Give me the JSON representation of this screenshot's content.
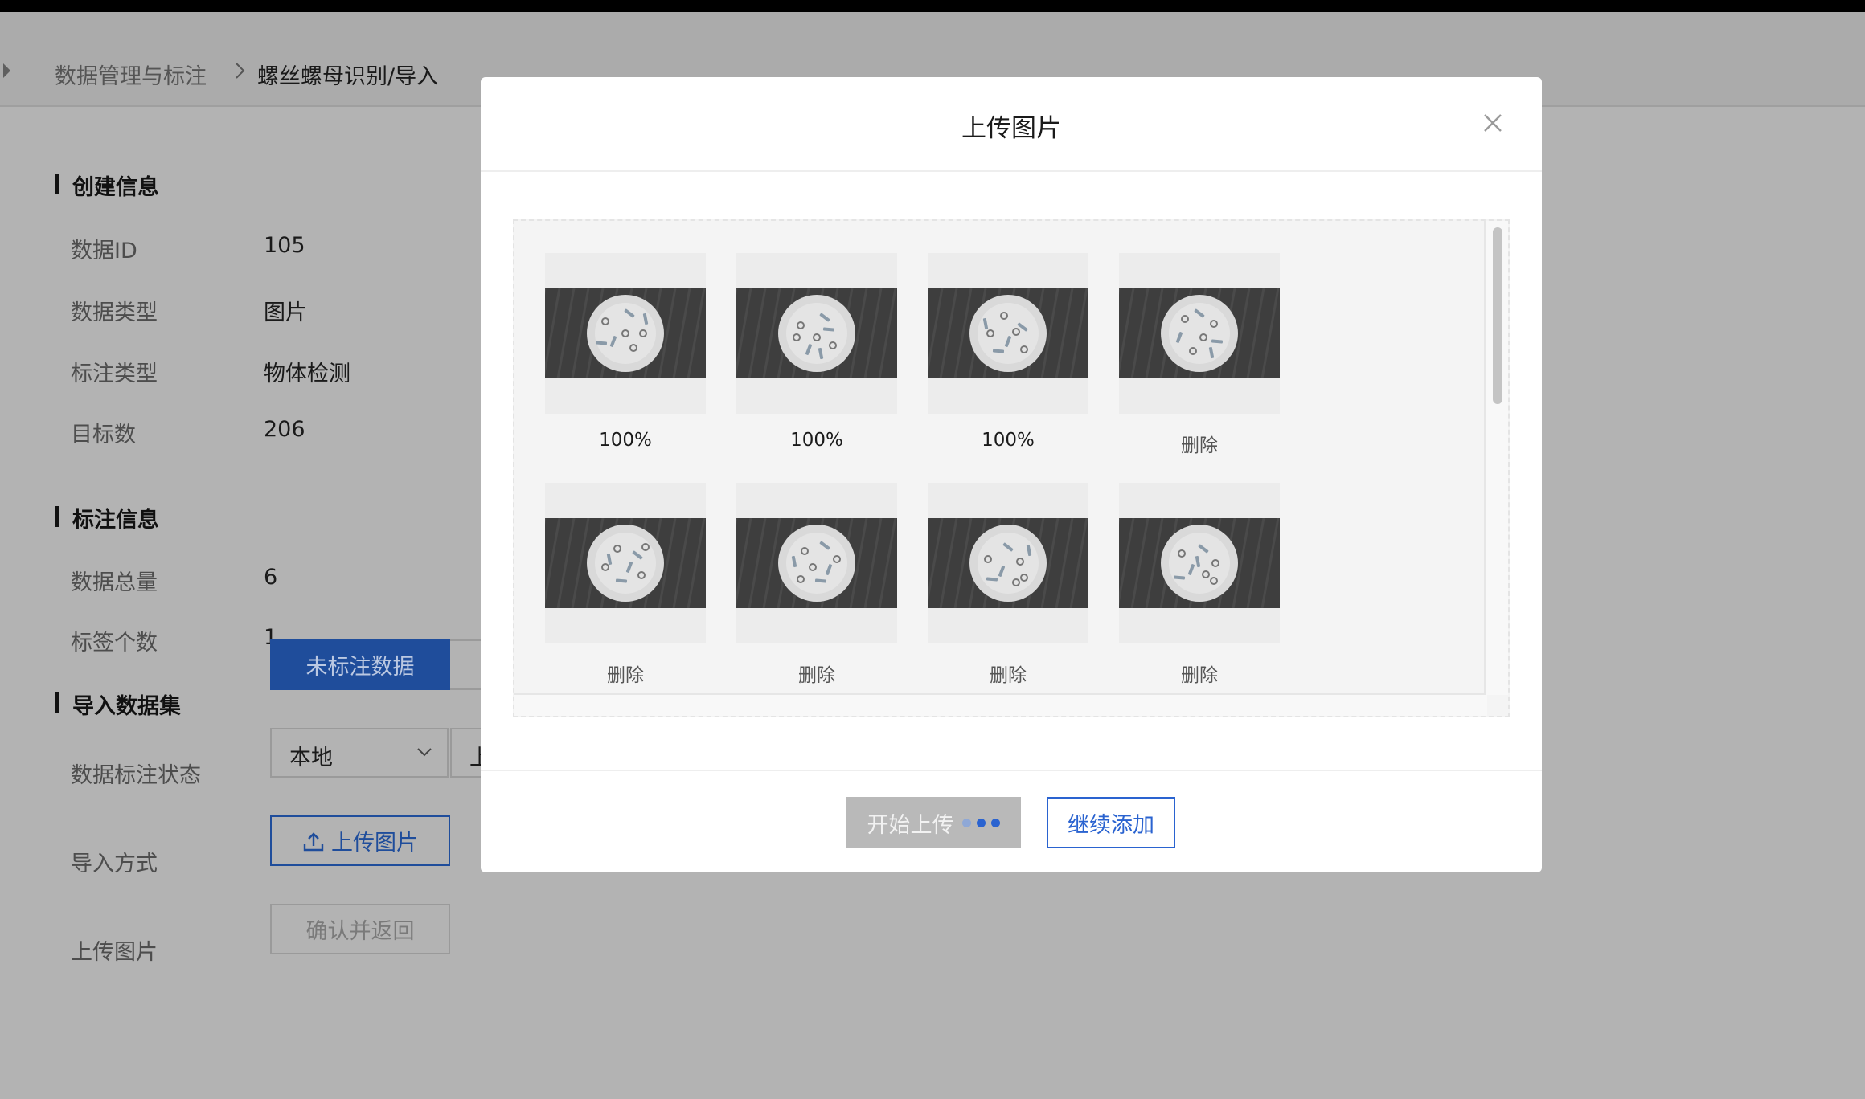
{
  "breadcrumb": {
    "parent": "数据管理与标注",
    "current": "螺丝螺母识别/导入"
  },
  "create_info": {
    "title": "创建信息",
    "rows": [
      {
        "label": "数据ID",
        "value": "105"
      },
      {
        "label": "数据类型",
        "value": "图片"
      },
      {
        "label": "标注类型",
        "value": "物体检测"
      },
      {
        "label": "目标数",
        "value": "206"
      }
    ]
  },
  "label_info": {
    "title": "标注信息",
    "rows": [
      {
        "label": "数据总量",
        "value": "6"
      },
      {
        "label": "标签个数",
        "value": "1"
      }
    ]
  },
  "import_dataset": {
    "title": "导入数据集",
    "status_label": "数据标注状态",
    "status_tab_active": "未标注数据",
    "method_label": "导入方式",
    "method_value": "本地",
    "method_second_value": "上",
    "upload_label": "上传图片",
    "upload_button": "上传图片",
    "confirm_button": "确认并返回"
  },
  "modal": {
    "title": "上传图片",
    "thumbnails": [
      {
        "caption": "100%"
      },
      {
        "caption": "100%"
      },
      {
        "caption": "100%"
      },
      {
        "caption": "删除"
      },
      {
        "caption": "删除"
      },
      {
        "caption": "删除"
      },
      {
        "caption": "删除"
      },
      {
        "caption": "删除"
      }
    ],
    "start_button": "开始上传",
    "continue_button": "继续添加"
  },
  "colors": {
    "primary": "#2a63d0",
    "overlay_primary": "#1f4d9b",
    "disabled_button": "#b9b9b9"
  },
  "icons": {
    "close": "close-icon",
    "upload": "upload-icon",
    "chevron": "chevron-down-icon",
    "breadcrumb_separator": "chevron-right-icon"
  }
}
